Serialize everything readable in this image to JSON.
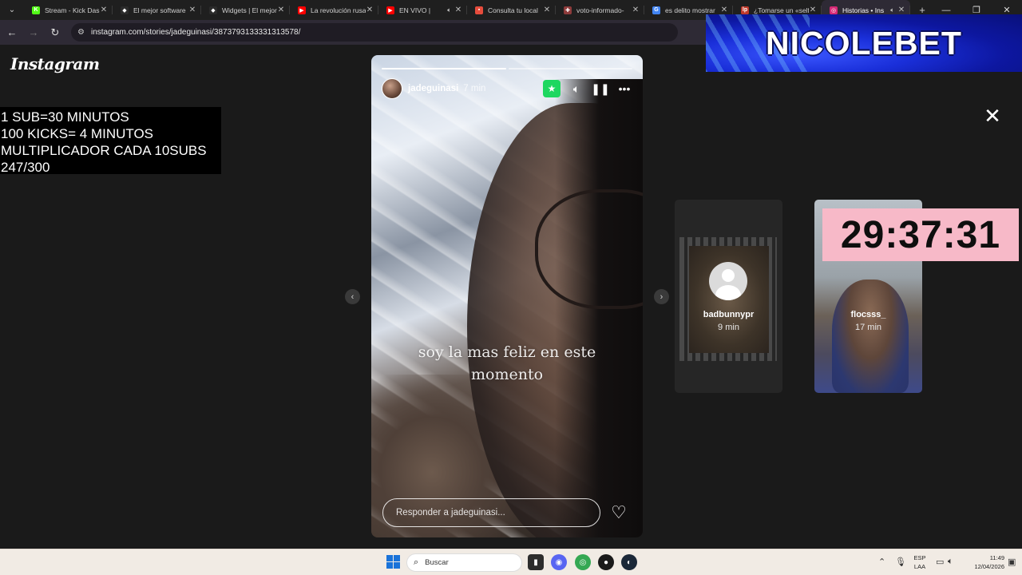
{
  "tabs": [
    {
      "title": "Stream - Kick Dash",
      "favicon_color": "#53fc18",
      "favicon": "K",
      "active": false
    },
    {
      "title": "El mejor software",
      "favicon_color": "#2b2b2b",
      "favicon": "◆",
      "active": false
    },
    {
      "title": "Widgets | El mejor",
      "favicon_color": "#2b2b2b",
      "favicon": "◆",
      "active": false
    },
    {
      "title": "La revolución rusa",
      "favicon_color": "#ff0000",
      "favicon": "▶",
      "active": false
    },
    {
      "title": "EN VIVO |",
      "favicon_color": "#ff0000",
      "favicon": "▶",
      "active": false,
      "audio": true
    },
    {
      "title": "Consulta tu local",
      "favicon_color": "#e74c3c",
      "favicon": "▪",
      "active": false
    },
    {
      "title": "voto-informado-",
      "favicon_color": "#8e3b3b",
      "favicon": "✚",
      "active": false
    },
    {
      "title": "es delito mostrar",
      "favicon_color": "#4285f4",
      "favicon": "G",
      "active": false
    },
    {
      "title": "¿Tomarse un «selfi",
      "favicon_color": "#c0392b",
      "favicon": "lp",
      "active": false
    },
    {
      "title": "Historias • Ins",
      "favicon_color": "#d62976",
      "favicon": "◎",
      "active": true,
      "audio": true
    }
  ],
  "new_tab_label": "+",
  "window_controls": {
    "minimize": "—",
    "restore": "❐",
    "close": "✕"
  },
  "address_bar": {
    "url": "instagram.com/stories/jadeguinasi/3873793133331313578/"
  },
  "page": {
    "logo": "Instagram",
    "overlay_rules": [
      "1 SUB=30 MINUTOS",
      "100 KICKS= 4 MINUTOS",
      "MULTIPLICADOR CADA 10SUBS",
      "247/300"
    ],
    "story": {
      "progress": {
        "segments": 2,
        "completed": 1
      },
      "username": "jadeguinasi",
      "time": "7 min",
      "caption": "soy la mas feliz en este momento",
      "reply_placeholder": "Responder a jadeguinasi..."
    },
    "side_stories": [
      {
        "username": "badbunnypr",
        "time": "9 min"
      },
      {
        "username": "flocsss_",
        "time": "17 min"
      }
    ],
    "timer": "29:37:31",
    "banner": "NICOLEBET"
  },
  "taskbar": {
    "search_placeholder": "Buscar",
    "lang_line1": "ESP",
    "lang_line2": "LAA",
    "time": "11:49",
    "date": "12/04/2026"
  }
}
